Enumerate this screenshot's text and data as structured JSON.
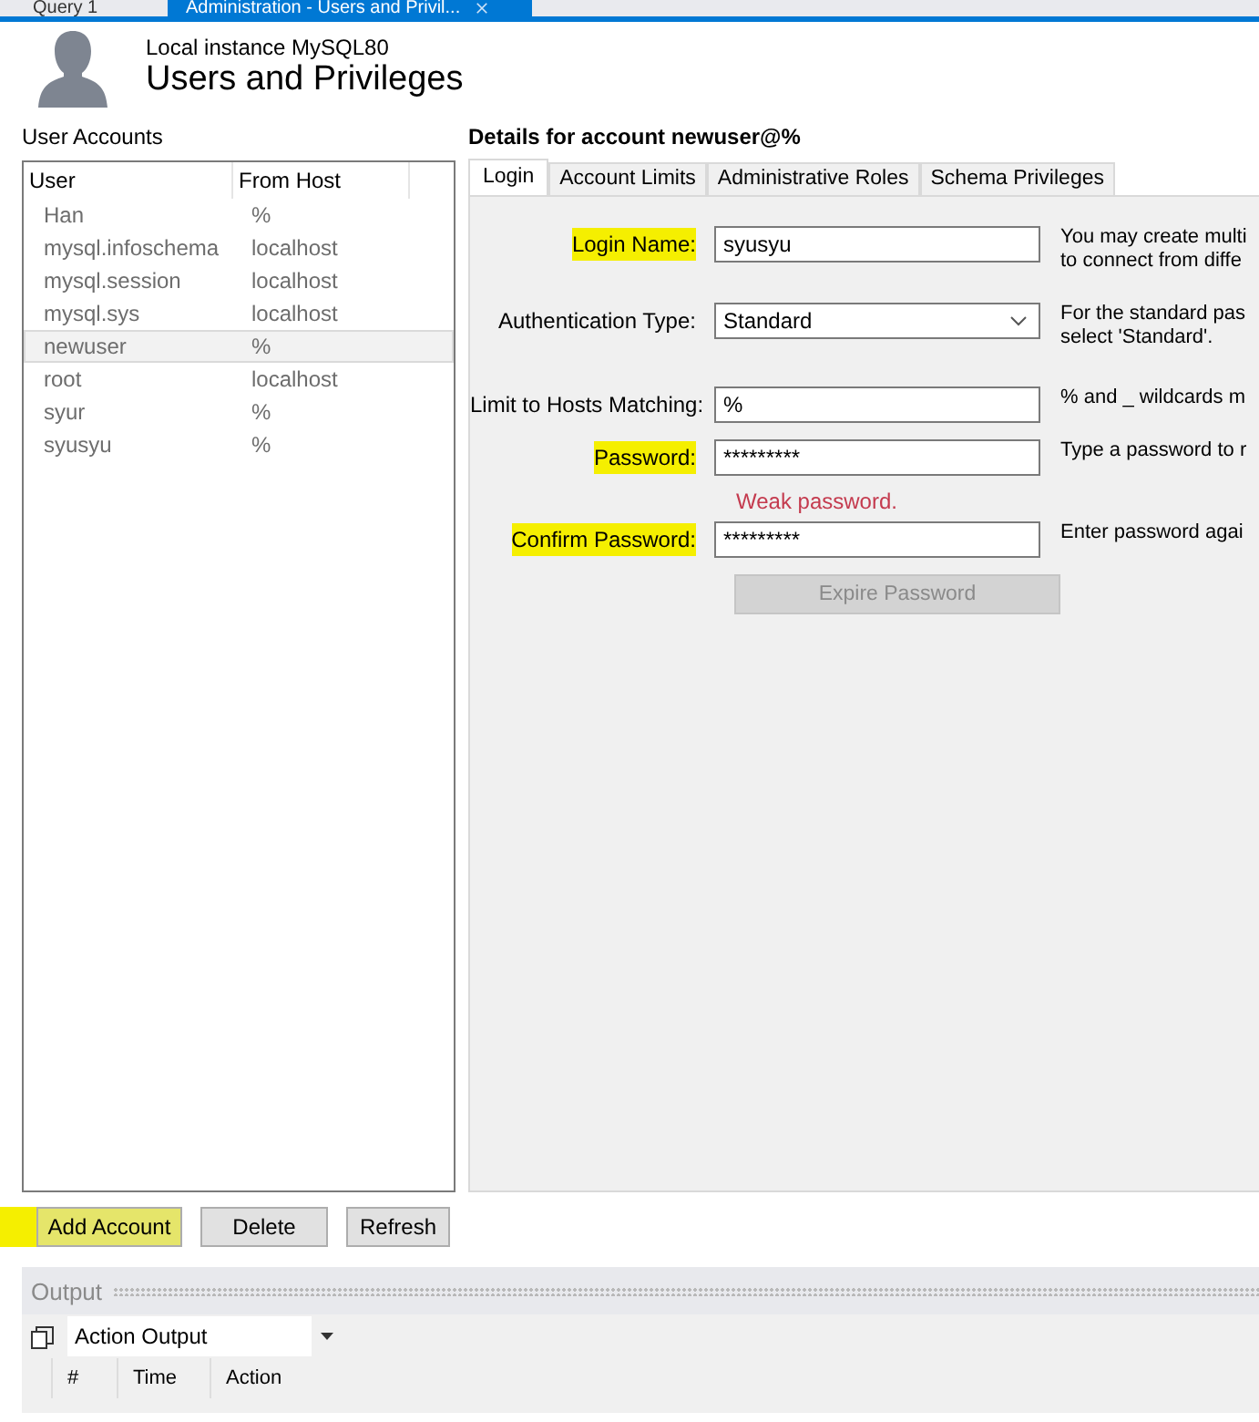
{
  "document_tabs": [
    {
      "label": "Query 1",
      "selected": false,
      "closable": false
    },
    {
      "label": "Administration - Users and Privil...",
      "selected": true,
      "closable": true
    }
  ],
  "header": {
    "subtitle": "Local instance MySQL80",
    "title": "Users and Privileges"
  },
  "accounts": {
    "heading": "User Accounts",
    "columns": [
      "User",
      "From Host"
    ],
    "rows": [
      {
        "user": "Han",
        "host": "%",
        "selected": false
      },
      {
        "user": "mysql.infoschema",
        "host": "localhost",
        "selected": false
      },
      {
        "user": "mysql.session",
        "host": "localhost",
        "selected": false
      },
      {
        "user": "mysql.sys",
        "host": "localhost",
        "selected": false
      },
      {
        "user": "newuser",
        "host": "%",
        "selected": true
      },
      {
        "user": "root",
        "host": "localhost",
        "selected": false
      },
      {
        "user": "syur",
        "host": "%",
        "selected": false
      },
      {
        "user": "syusyu",
        "host": "%",
        "selected": false
      }
    ]
  },
  "details": {
    "heading": "Details for account newuser@%",
    "tabs": [
      {
        "label": "Login",
        "selected": true
      },
      {
        "label": "Account Limits",
        "selected": false
      },
      {
        "label": "Administrative Roles",
        "selected": false
      },
      {
        "label": "Schema Privileges",
        "selected": false
      }
    ],
    "fields": [
      {
        "kind": "text",
        "label": "Login Name:",
        "value": "syusyu",
        "help": [
          "You may create multi",
          "to connect from diffe"
        ],
        "highlighted": true
      },
      {
        "kind": "select",
        "label": "Authentication Type:",
        "value": "Standard",
        "help": [
          "For the standard pas",
          "select 'Standard'."
        ],
        "highlighted": false
      },
      {
        "kind": "text",
        "label": "Limit to Hosts Matching:",
        "value": "%",
        "help": [
          "% and _ wildcards m"
        ],
        "highlighted": false
      },
      {
        "kind": "text",
        "label": "Password:",
        "value": "*********",
        "help": [
          "Type a password to r"
        ],
        "highlighted": true,
        "note": "Weak password."
      },
      {
        "kind": "text",
        "label": "Confirm Password:",
        "value": "*********",
        "help": [
          "Enter password agai"
        ],
        "highlighted": true
      }
    ],
    "expire_button": {
      "label": "Expire Password",
      "disabled": true
    }
  },
  "buttons": [
    {
      "label": "Add Account",
      "highlighted": true
    },
    {
      "label": "Delete",
      "highlighted": false
    },
    {
      "label": "Refresh",
      "highlighted": false
    }
  ],
  "output": {
    "title": "Output",
    "selector": "Action Output",
    "columns": [
      "#",
      "Time",
      "Action"
    ]
  }
}
